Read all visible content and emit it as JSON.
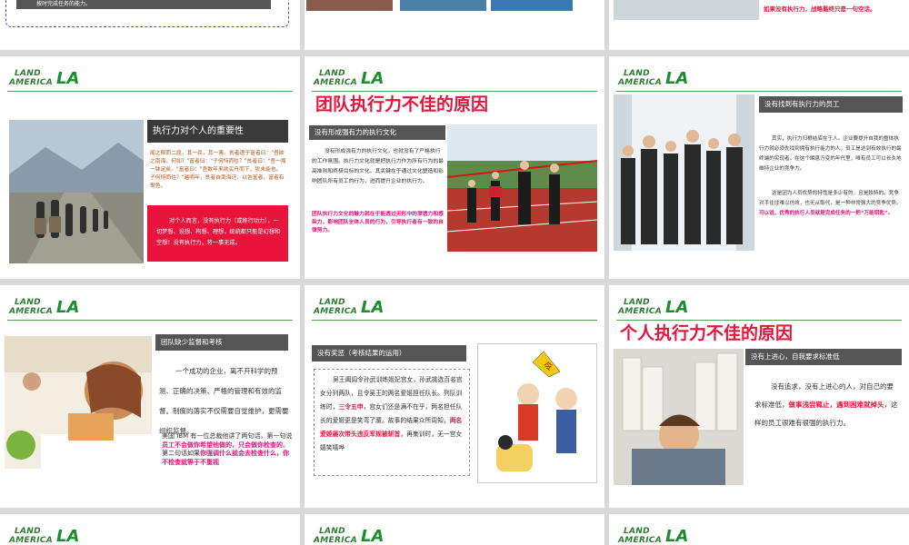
{
  "top_row": {
    "s1_fragment": "按时完成任务的能力。",
    "s3_fragment": "如果没有执行力，战略最终只是一句空话。"
  },
  "logo": {
    "line1": "LAND",
    "line2": "AMERICA",
    "mark": "LA"
  },
  "slide_a": {
    "header": "执行力对个人的重要性",
    "quote": "闻之郁而二屈，其一民，其一害。贫者语于富者曰：\"吾欲之南海，何如？\"富者曰：\"子何恃而往？\"贫者曰：\"吾一瓶一钵足矣。\"富者曰：\"吾数年来欲买舟而下，犹未能也。子何恃而往？\"越明年，贫者自南海还，以告富者，富者有惭色。",
    "red_text": "对个人而言，没有执行力（或称行动力），一切梦想、设想、构想、理想，统统都只能是幻想和空想！没有执行力，将一事无成。"
  },
  "slide_b": {
    "title": "团队执行力不佳的原因",
    "header": "没有形成强有力的执行文化",
    "body": "没有形成强有力的执行文化，也就没有了严格执行的工作氛围。执行力文化就是把执行力作为所有行为的最高准则和终极目标的文化。其关键在于通过文化塑造和影响团队所有员工的行为，进而提升企业的执行力。",
    "pink": "团队执行力文化的魅力就在于能透过无形中的渗透力和感染力，影响团队全体人员的行为，引导执行者有一致的自律努力。"
  },
  "slide_c": {
    "header": "没有找到有执行力的员工",
    "body1": "其实，执行力归根结底在于人。企业要提升自我的整体执行力就必须先找到拥有执行能力的人。员工是达到有效执行的最终端的实现者。在这个瞬息万变的年代里，唯有员工可以长久地维持企业的竞争力。",
    "body2": "这是因为人员优势的特性是多少有的，且是独特的。竞争对手往往难以仿效，也无从取代，是一种非常强大的竞争优势。",
    "pink": "可以说，优秀的执行人员就是完成任务的一把“万能钥匙”。"
  },
  "slide_d": {
    "header": "团队缺少监督和考核",
    "body": "一个成功的企业，离不开科学的预测、正确的决策、严格的管理和有效的监督。制度的落实不仅需要自觉维护，更需要组织监督。",
    "ibm": "美国 IBM 有一位总裁他讲了两句话，第一句说",
    "pink1": "员工不会做你希望他做的，只会做你检查的",
    "mid": "。第二句话如果",
    "pink2": "你强调什么就会去检查什么，你不检查就等于不重视"
  },
  "slide_e": {
    "header": "没有奖惩（考核结果的运用）",
    "body_a": "吴王阖闾令孙武训练姬妃宫女，孙武挑选百名宫女分列两队，且令吴王的两名爱姬担任队长。列队训练时，",
    "red1": "三令五申",
    "body_b": "，宫女们还是满不在乎，两名担任队长的爱姬更是笑弯了腰。故事的结果众所周知，",
    "red2": "两名爱姬屡次带头违反军规被斩首",
    "body_c": "，再集训时，无一宫女嬉笑嘻哗",
    "flag": "令"
  },
  "slide_f": {
    "title": "个人执行力不佳的原因",
    "header": "没有上进心，自我要求标准低",
    "body_a": "没有追求，没有上进心的人，对自己的要求标准低，",
    "red": "做事浅尝辄止，遇到困难就掉头",
    "body_b": "，这样的员工很难有很强的执行力。"
  }
}
